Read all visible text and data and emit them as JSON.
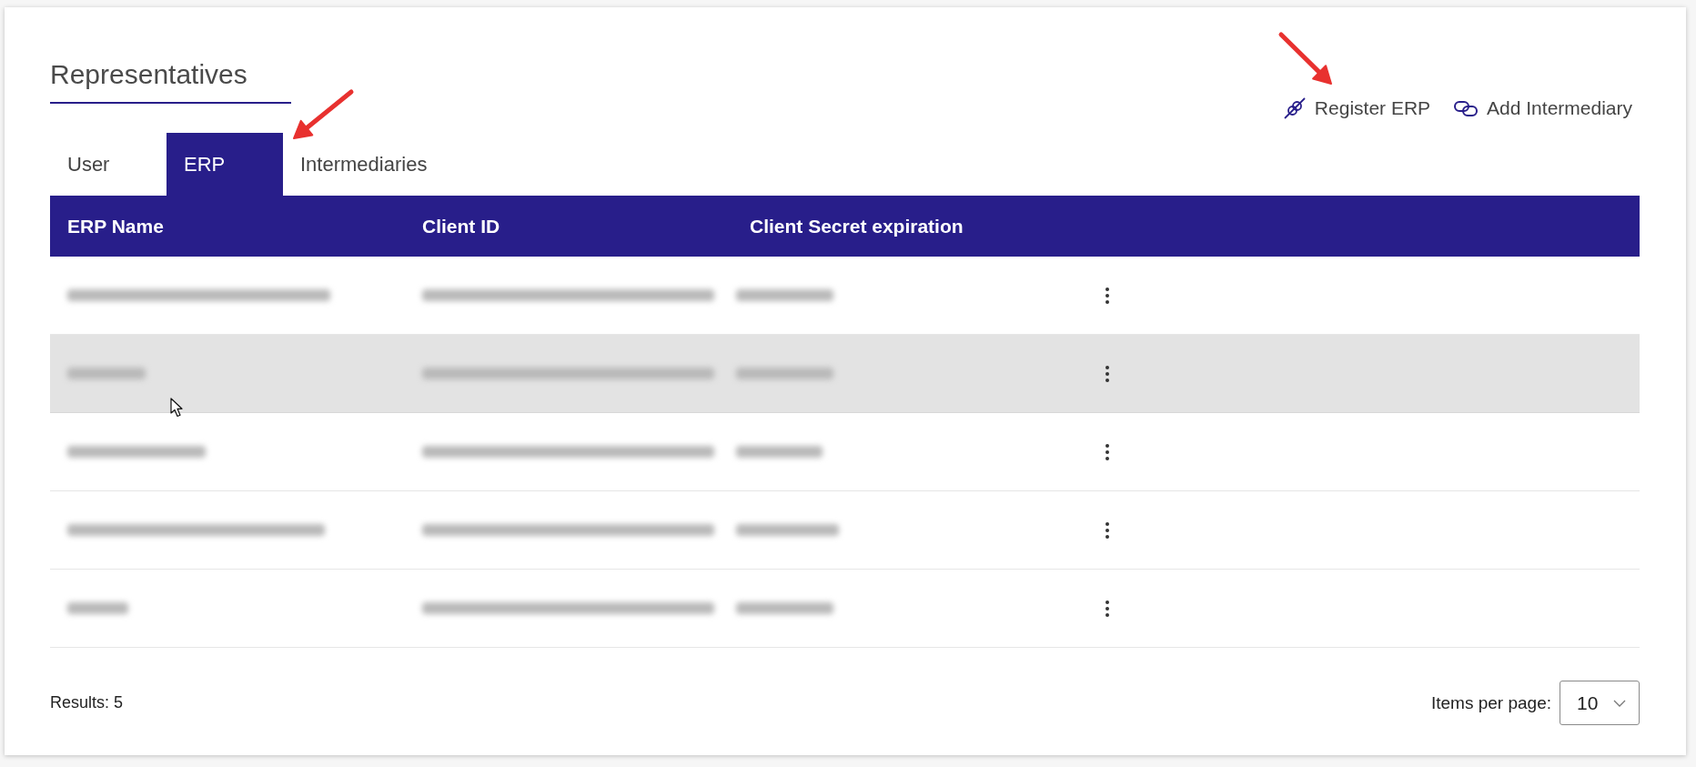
{
  "title": "Representatives",
  "actions": [
    {
      "kind": "register",
      "label": "Register ERP"
    },
    {
      "kind": "add",
      "label": "Add Intermediary"
    }
  ],
  "tabs": [
    {
      "label": "User",
      "selected": false
    },
    {
      "label": "ERP",
      "selected": true
    },
    {
      "label": "Intermediaries",
      "selected": false
    }
  ],
  "table": {
    "columns": [
      "ERP Name",
      "Client ID",
      "Client Secret expiration"
    ],
    "rows": [
      {
        "highlighted": false
      },
      {
        "highlighted": true
      },
      {
        "highlighted": false
      },
      {
        "highlighted": false
      },
      {
        "highlighted": false
      }
    ]
  },
  "footer": {
    "results": "Results: 5",
    "items_per_page": {
      "label": "Items per page:",
      "value": "10"
    }
  }
}
